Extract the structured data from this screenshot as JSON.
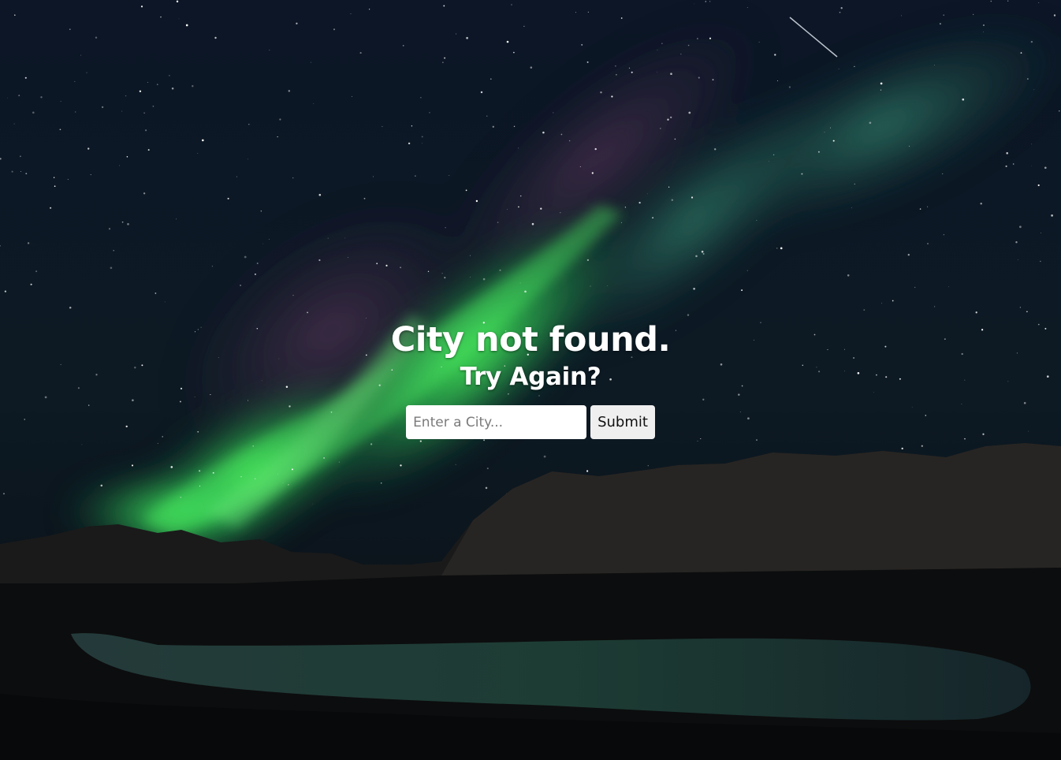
{
  "message": {
    "title": "City not found.",
    "subtitle": "Try Again?"
  },
  "search": {
    "placeholder": "Enter a City...",
    "value": "",
    "submit_label": "Submit"
  },
  "background": {
    "icon": "aurora-night-sky-photo",
    "colors": {
      "sky": "#0b1420",
      "aurora_green": "#3cff5a",
      "aurora_purple": "#5a3a5e",
      "mountains": "#141414",
      "lake": "#1c3a34"
    }
  }
}
